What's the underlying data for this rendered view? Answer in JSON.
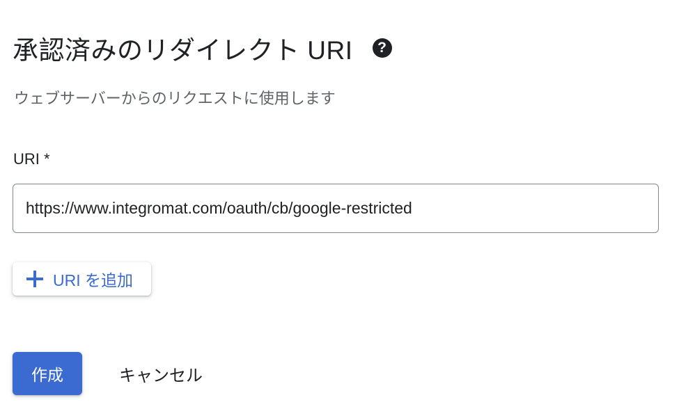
{
  "section": {
    "title": "承認済みのリダイレクト URI",
    "help_icon": "?",
    "description": "ウェブサーバーからのリクエストに使用します"
  },
  "uri_field": {
    "label": "URI *",
    "value": "https://www.integromat.com/oauth/cb/google-restricted"
  },
  "add_uri": {
    "icon": "plus-icon",
    "label": "URI を追加"
  },
  "actions": {
    "create_label": "作成",
    "cancel_label": "キャンセル"
  },
  "colors": {
    "accent": "#3b6bd0",
    "text_primary": "#202124",
    "text_secondary": "#5f6368",
    "border": "#80868b"
  }
}
